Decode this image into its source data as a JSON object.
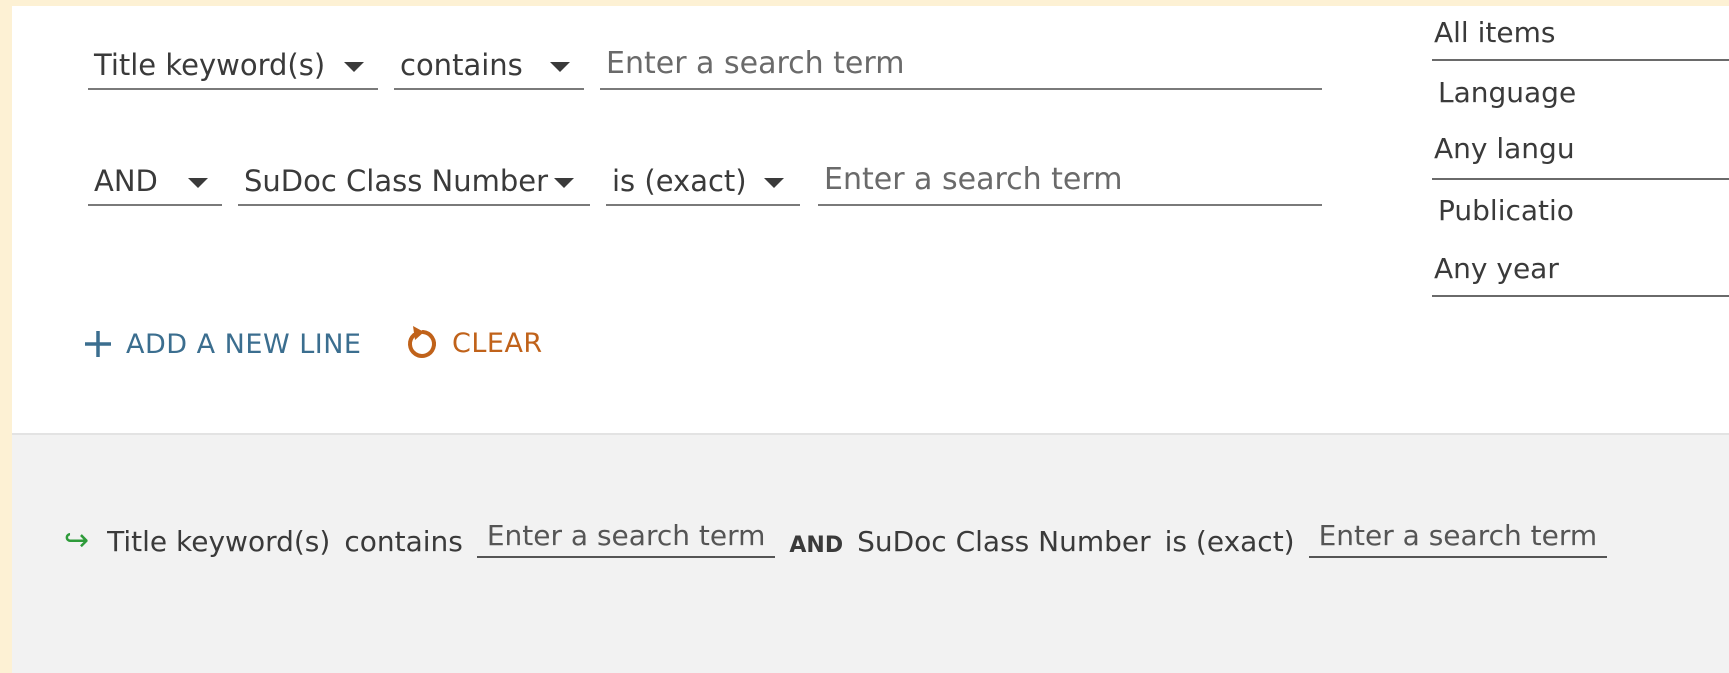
{
  "row1": {
    "field": "Title keyword(s)",
    "operator": "contains",
    "placeholder": "Enter a search term"
  },
  "row2": {
    "boolean": "AND",
    "field": "SuDoc Class Number",
    "operator": "is (exact)",
    "placeholder": "Enter a search term"
  },
  "actions": {
    "add_line": "ADD A NEW LINE",
    "clear": "CLEAR"
  },
  "sidebar": {
    "items_type": "All items",
    "language_label": "Language",
    "language_value": "Any langu",
    "publication_label": "Publicatio",
    "year_value": "Any year"
  },
  "summary": {
    "arrow": "↪",
    "field1": "Title keyword(s)",
    "operator1": "contains",
    "term1": "Enter a search term",
    "boolean": "AND",
    "field2": "SuDoc Class Number",
    "operator2": "is (exact)",
    "term2": "Enter a search term"
  },
  "colors": {
    "outer_background": "#fdf1d4",
    "add_line": "#3b6e8f",
    "clear": "#c0621a",
    "summary_arrow": "#2e9b3a"
  }
}
